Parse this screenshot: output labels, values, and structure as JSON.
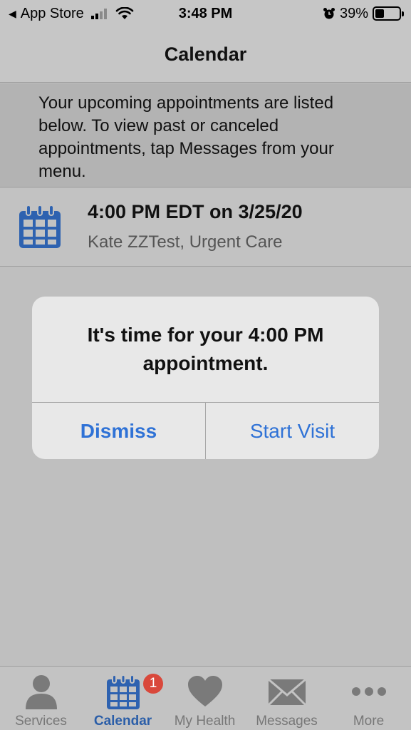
{
  "status_bar": {
    "back_app": "App Store",
    "time": "3:48 PM",
    "battery": "39%",
    "battery_level": 0.39
  },
  "nav": {
    "title": "Calendar"
  },
  "info": {
    "text": "Your upcoming appointments are listed below. To view past or canceled appointments, tap Messages from your menu."
  },
  "appointment": {
    "time": "4:00 PM EDT on 3/25/20",
    "detail": "Kate ZZTest, Urgent Care",
    "icon": "calendar-icon"
  },
  "alert": {
    "message_line1": "It's time for your 4:00 PM",
    "message_line2": "appointment.",
    "dismiss_label": "Dismiss",
    "start_label": "Start Visit"
  },
  "tabs": [
    {
      "label": "Services",
      "icon": "person-icon"
    },
    {
      "label": "Calendar",
      "icon": "calendar-icon",
      "badge": "1",
      "active": true
    },
    {
      "label": "My Health",
      "icon": "heart-icon"
    },
    {
      "label": "Messages",
      "icon": "envelope-icon"
    },
    {
      "label": "More",
      "icon": "more-dots-icon"
    }
  ],
  "colors": {
    "accent": "#2f72d6",
    "tab_active": "#2b5ea8",
    "badge": "#d9483b",
    "calendar_icon": "#2e62b0"
  }
}
